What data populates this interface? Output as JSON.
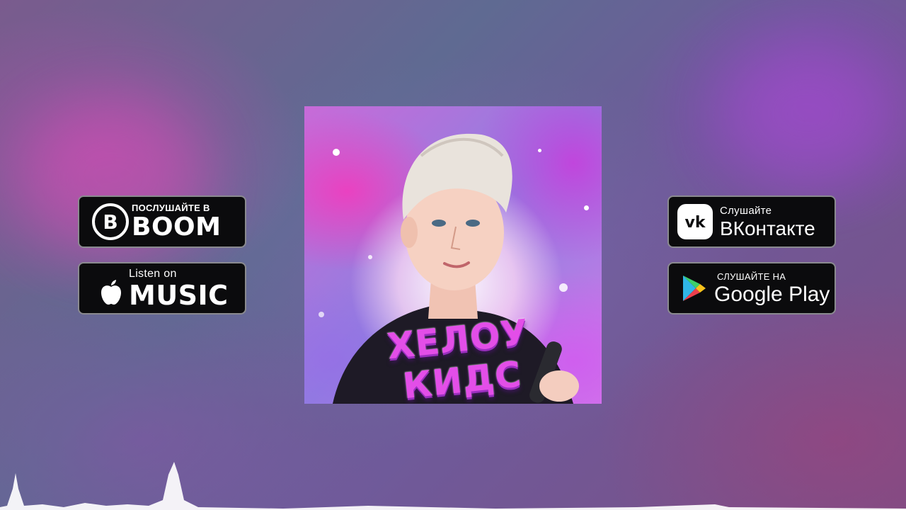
{
  "badges": {
    "boom": {
      "small": "ПОСЛУШАЙТЕ В",
      "big": "BOOM",
      "icon": "boom-b-icon"
    },
    "apple": {
      "small": "Listen on",
      "big": "MUSIC",
      "icon": "apple-icon"
    },
    "vk": {
      "small": "Слушайте",
      "big": "ВКонтакте",
      "icon": "vk-icon"
    },
    "google_play": {
      "small": "СЛУШАЙТЕ НА",
      "big": "Google Play",
      "icon": "google-play-icon"
    }
  },
  "cover": {
    "title": "ХЕЛОУ КИДС"
  },
  "colors": {
    "badge_bg": "#0b0b0d",
    "badge_border": "#8a8a8f",
    "title": "#e34ee8"
  }
}
